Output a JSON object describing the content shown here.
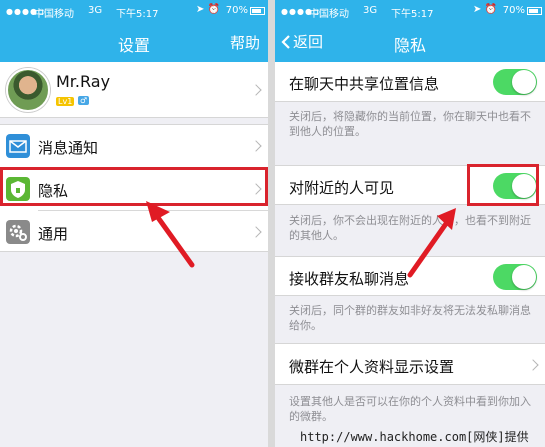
{
  "status_left": {
    "carrier": "中国移动",
    "network": "3G",
    "time": "下午5:17",
    "battery": "70%"
  },
  "status_right": {
    "carrier": "中国移动",
    "network": "3G",
    "time": "下午5:17",
    "battery": "70%"
  },
  "left": {
    "nav_title": "设置",
    "nav_right": "帮助",
    "profile": {
      "name": "Mr.Ray",
      "level_badge": "Lv1",
      "gender_badge": "♂"
    },
    "items": [
      {
        "label": "消息通知",
        "icon": "envelope-icon",
        "color": "#2f8fd8"
      },
      {
        "label": "隐私",
        "icon": "shield-icon",
        "color": "#5bb734"
      },
      {
        "label": "通用",
        "icon": "gear-icon",
        "color": "#8a8a8a"
      }
    ]
  },
  "right": {
    "nav_back": "返回",
    "nav_title": "隐私",
    "settings": [
      {
        "label": "在聊天中共享位置信息",
        "toggle": true,
        "desc": "关闭后，将隐藏你的当前位置，你在聊天中也看不到他人的位置。"
      },
      {
        "label": "对附近的人可见",
        "toggle": true,
        "desc": "关闭后，你不会出现在附近的人中，也看不到附近的其他人。"
      },
      {
        "label": "接收群友私聊消息",
        "toggle": true,
        "desc": "关闭后，同个群的群友如非好友将无法发私聊消息给你。"
      },
      {
        "label": "微群在个人资料显示设置",
        "toggle": false,
        "desc": "设置其他人是否可以在你的个人资料中看到你加入的微群。"
      }
    ]
  },
  "watermark": "http://www.hackhome.com[网侠]提供",
  "colors": {
    "bar": "#2fb3ea",
    "toggle_on": "#4cd964",
    "highlight": "#d9232d"
  }
}
